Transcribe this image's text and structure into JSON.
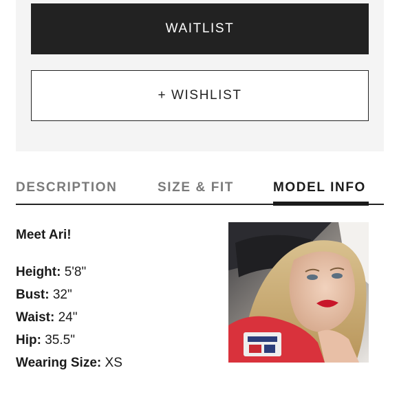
{
  "actions": {
    "waitlist_label": "WAITLIST",
    "wishlist_label": "+ WISHLIST"
  },
  "tabs": [
    {
      "label": "DESCRIPTION",
      "active": false
    },
    {
      "label": "SIZE & FIT",
      "active": false
    },
    {
      "label": "MODEL INFO",
      "active": true
    }
  ],
  "model_info": {
    "intro": "Meet Ari!",
    "stats": [
      {
        "label": "Height:",
        "value": "5'8\""
      },
      {
        "label": "Bust:",
        "value": "32\""
      },
      {
        "label": "Waist:",
        "value": "24\""
      },
      {
        "label": "Hip:",
        "value": "35.5\""
      },
      {
        "label": "Wearing Size:",
        "value": "XS"
      }
    ]
  },
  "colors": {
    "primary_button": "#222222",
    "panel_background": "#f4f4f4",
    "inactive_tab": "#7a7a7a",
    "shirt": "#d9323c"
  }
}
